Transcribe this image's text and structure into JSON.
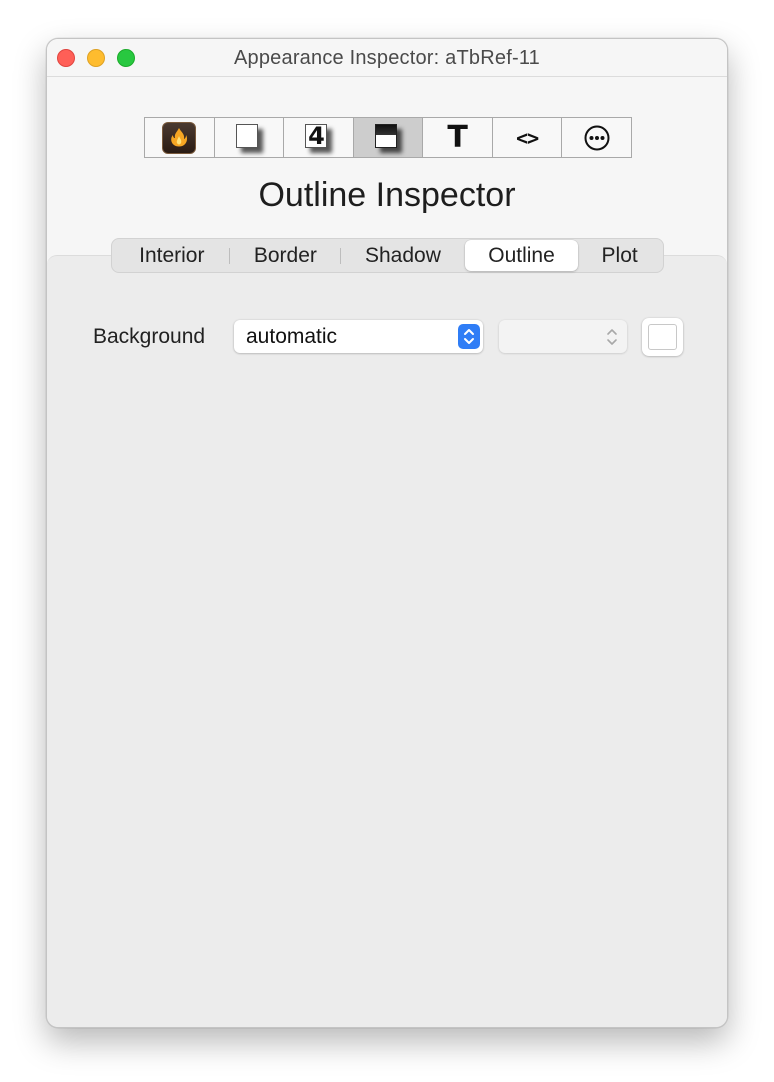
{
  "window": {
    "title": "Appearance Inspector: aTbRef-11"
  },
  "toolbar": {
    "buttons": [
      {
        "name": "flame-icon",
        "active": false
      },
      {
        "name": "shadowed-square-icon",
        "active": false
      },
      {
        "name": "badge-four-icon",
        "glyph": "4",
        "active": false
      },
      {
        "name": "dark-square-icon",
        "active": true
      },
      {
        "name": "text-t-icon",
        "glyph": "T",
        "active": false
      },
      {
        "name": "code-brackets-icon",
        "glyph": "<>",
        "active": false
      },
      {
        "name": "ellipsis-circle-icon",
        "active": false
      }
    ]
  },
  "inspector": {
    "title": "Outline Inspector"
  },
  "tabs": [
    {
      "label": "Interior",
      "selected": false
    },
    {
      "label": "Border",
      "selected": false
    },
    {
      "label": "Shadow",
      "selected": false
    },
    {
      "label": "Outline",
      "selected": true
    },
    {
      "label": "Plot",
      "selected": false
    }
  ],
  "background": {
    "label": "Background",
    "value": "automatic",
    "secondary_value": "",
    "swatch_color": "#ffffff"
  },
  "colors": {
    "accent": "#2f7df6",
    "flame": "#f5a623"
  }
}
